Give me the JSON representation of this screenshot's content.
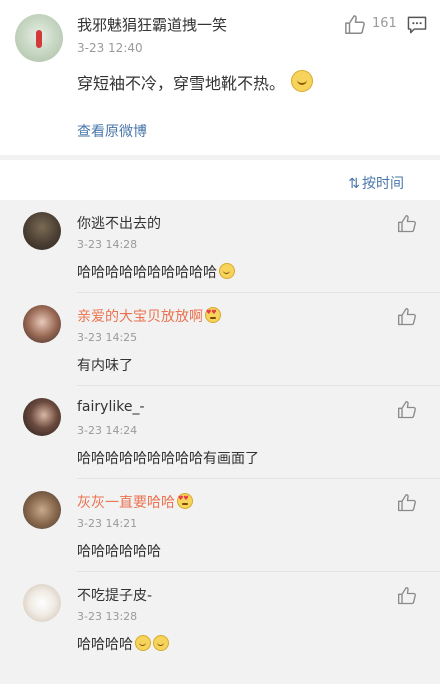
{
  "post": {
    "author": "我邪魅狷狂霸道拽一笑",
    "time": "3-23 12:40",
    "like_count": "161",
    "text": "穿短袖不冷，穿雪地靴不热。",
    "view_original": "查看原微博",
    "icons": {
      "like": "thumbs-up-icon",
      "comment": "comment-icon",
      "emoji": "grin-emoji"
    }
  },
  "sort": {
    "label": "按时间",
    "icon": "sort-icon"
  },
  "comments": [
    {
      "name": "你逃不出去的",
      "time": "3-23 14:28",
      "text": "哈哈哈哈哈哈哈哈哈哈",
      "emoji": "laugh-cry",
      "highlight": false
    },
    {
      "name": "亲爱的大宝贝放放啊",
      "time": "3-23 14:25",
      "text": "有内味了",
      "name_emoji": "heart-eyes",
      "highlight": true
    },
    {
      "name": "fairylike_-",
      "time": "3-23 14:24",
      "text": "哈哈哈哈哈哈哈哈哈有画面了",
      "highlight": false
    },
    {
      "name": "灰灰一直要哈哈",
      "time": "3-23 14:21",
      "text": "哈哈哈哈哈哈",
      "name_emoji": "heart-eyes",
      "highlight": true
    },
    {
      "name": "不吃提子皮-",
      "time": "3-23 13:28",
      "text": "哈哈哈哈",
      "emoji": "laugh-cry x2",
      "highlight": false
    }
  ],
  "colors": {
    "link": "#4a77a9",
    "highlight_name": "#eb7350",
    "meta": "#9a9a9a",
    "background": "#f2f2f2"
  }
}
